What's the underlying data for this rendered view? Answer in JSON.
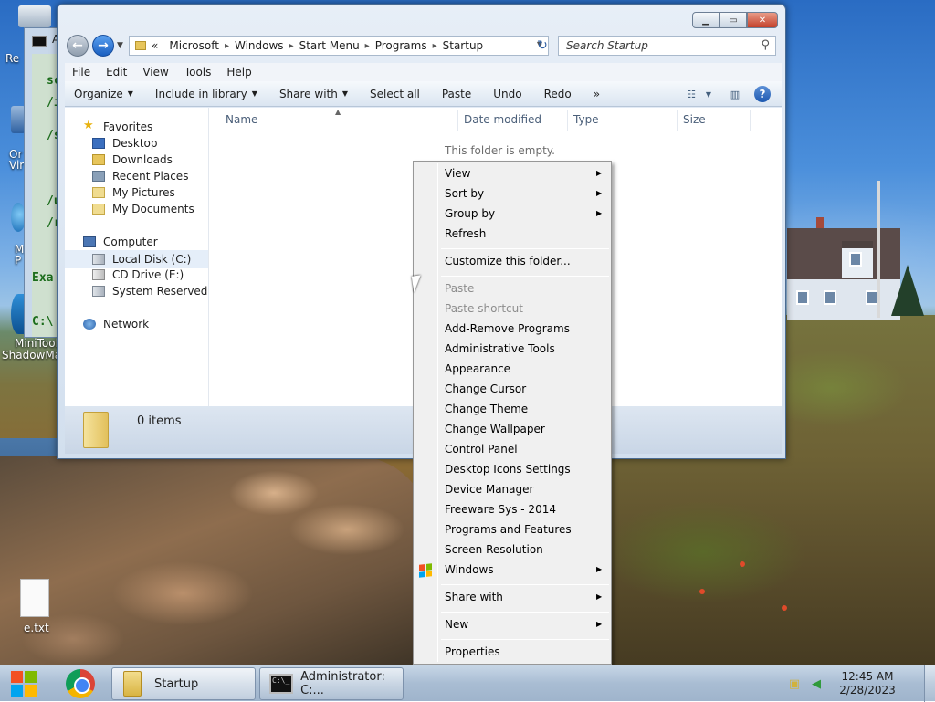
{
  "desktop": {
    "icons": [
      {
        "label": "Re"
      },
      {
        "label": "Or"
      },
      {
        "label": "Vir"
      },
      {
        "label": "M"
      },
      {
        "label": "P"
      },
      {
        "label": "MiniTool"
      },
      {
        "label": "ShadowMa"
      },
      {
        "label": "e.txt"
      }
    ]
  },
  "console": {
    "title_fragment": "A",
    "lines": [
      "sc",
      "/i",
      "/s",
      "/u",
      "/r",
      "Exa",
      "C:\\"
    ]
  },
  "explorer": {
    "address": {
      "prefix": "«",
      "crumbs": [
        "Microsoft",
        "Windows",
        "Start Menu",
        "Programs",
        "Startup"
      ]
    },
    "search_placeholder": "Search Startup",
    "menu": [
      "File",
      "Edit",
      "View",
      "Tools",
      "Help"
    ],
    "commands": [
      {
        "label": "Organize",
        "dropdown": true
      },
      {
        "label": "Include in library",
        "dropdown": true
      },
      {
        "label": "Share with",
        "dropdown": true
      },
      {
        "label": "Select all",
        "dropdown": false
      },
      {
        "label": "Paste",
        "dropdown": false
      },
      {
        "label": "Undo",
        "dropdown": false
      },
      {
        "label": "Redo",
        "dropdown": false
      }
    ],
    "more_glyph": "»",
    "nav": {
      "favorites": {
        "label": "Favorites",
        "items": [
          "Desktop",
          "Downloads",
          "Recent Places",
          "My Pictures",
          "My Documents"
        ]
      },
      "computer": {
        "label": "Computer",
        "items": [
          "Local Disk (C:)",
          "CD Drive (E:)",
          "System Reserved ("
        ]
      },
      "network": {
        "label": "Network"
      }
    },
    "columns": [
      "Name",
      "Date modified",
      "Type",
      "Size"
    ],
    "empty_message": "This folder is empty.",
    "item_count": "0 items"
  },
  "context_menu": {
    "items": [
      {
        "label": "View",
        "submenu": true,
        "disabled": false
      },
      {
        "label": "Sort by",
        "submenu": true,
        "disabled": false
      },
      {
        "label": "Group by",
        "submenu": true,
        "disabled": false
      },
      {
        "label": "Refresh",
        "submenu": false,
        "disabled": false
      },
      {
        "label": "Customize this folder...",
        "submenu": false,
        "disabled": false
      },
      {
        "label": "Paste",
        "submenu": false,
        "disabled": true
      },
      {
        "label": "Paste shortcut",
        "submenu": false,
        "disabled": true
      },
      {
        "label": "Add-Remove Programs",
        "submenu": false,
        "disabled": false
      },
      {
        "label": "Administrative Tools",
        "submenu": false,
        "disabled": false
      },
      {
        "label": "Appearance",
        "submenu": false,
        "disabled": false
      },
      {
        "label": "Change Cursor",
        "submenu": false,
        "disabled": false
      },
      {
        "label": "Change Theme",
        "submenu": false,
        "disabled": false
      },
      {
        "label": "Change Wallpaper",
        "submenu": false,
        "disabled": false
      },
      {
        "label": "Control Panel",
        "submenu": false,
        "disabled": false
      },
      {
        "label": "Desktop Icons Settings",
        "submenu": false,
        "disabled": false
      },
      {
        "label": "Device Manager",
        "submenu": false,
        "disabled": false
      },
      {
        "label": "Freeware Sys - 2014",
        "submenu": false,
        "disabled": false
      },
      {
        "label": "Programs and Features",
        "submenu": false,
        "disabled": false
      },
      {
        "label": "Screen Resolution",
        "submenu": false,
        "disabled": false
      },
      {
        "label": "Windows",
        "submenu": true,
        "disabled": false
      },
      {
        "label": "Share with",
        "submenu": true,
        "disabled": false
      },
      {
        "label": "New",
        "submenu": true,
        "disabled": false
      },
      {
        "label": "Properties",
        "submenu": false,
        "disabled": false
      }
    ]
  },
  "taskbar": {
    "buttons": [
      {
        "label": "Startup"
      },
      {
        "label": "Administrator: C:..."
      }
    ],
    "clock": {
      "time": "12:45 AM",
      "date": "2/28/2023"
    }
  },
  "colors": {
    "win_flag": [
      "#f25022",
      "#7fba00",
      "#00a4ef",
      "#ffb900"
    ]
  }
}
